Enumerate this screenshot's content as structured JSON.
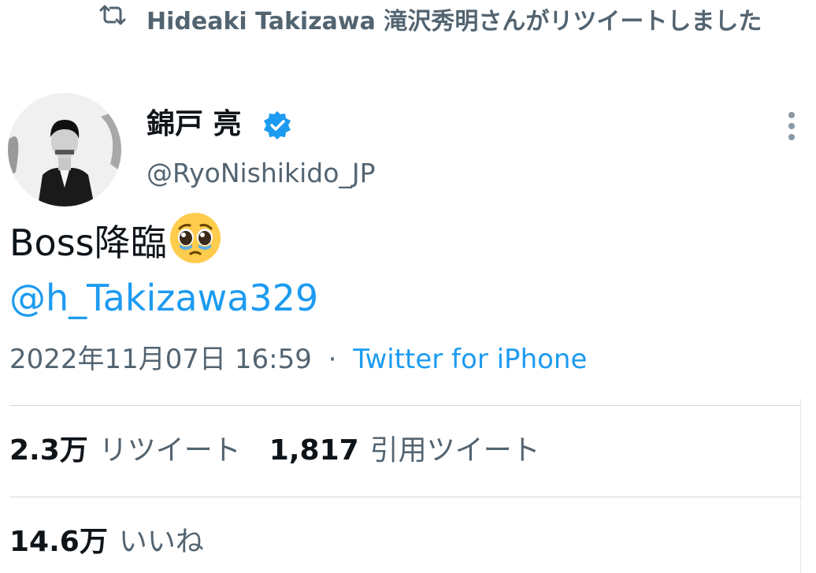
{
  "retweet_banner": {
    "icon": "retweet-icon",
    "text": "Hideaki Takizawa 滝沢秀明さんがリツイートしました"
  },
  "author": {
    "display_name": "錦戸 亮",
    "verified_icon": "verified-badge-icon",
    "handle": "@RyoNishikido_JP",
    "avatar_icon": "avatar-photo"
  },
  "more_icon": "more-options-icon",
  "tweet": {
    "text": "Boss降臨",
    "emoji": "pleading-face-emoji",
    "mention": "@h_Takizawa329"
  },
  "meta": {
    "timestamp": "2022年11月07日 16:59",
    "separator": "·",
    "source": "Twitter for iPhone"
  },
  "stats": {
    "retweets": {
      "count": "2.3万",
      "label": "リツイート"
    },
    "quotes": {
      "count": "1,817",
      "label": "引用ツイート"
    },
    "likes": {
      "count": "14.6万",
      "label": "いいね"
    }
  },
  "colors": {
    "link": "#1d9bf0",
    "secondary_text": "#536471",
    "primary_text": "#0f1419",
    "divider": "#cfd9de"
  }
}
